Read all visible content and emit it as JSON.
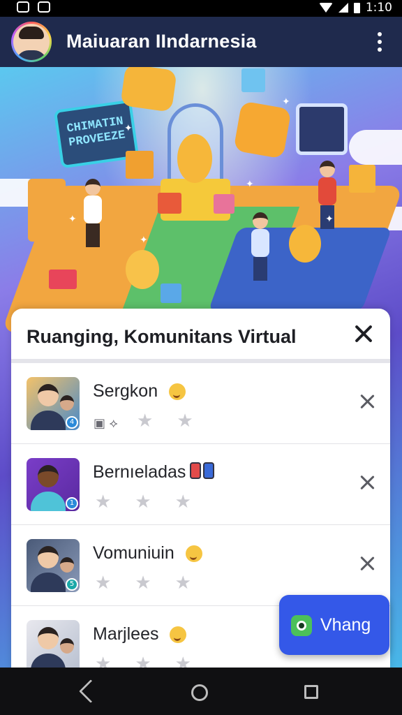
{
  "status_bar": {
    "time": "1:10"
  },
  "app_bar": {
    "title": "Maiuaran IIndarnesia"
  },
  "hero": {
    "sign_text": "CHIMATIN PROVEEZE"
  },
  "dialog": {
    "title": "Ruanging, Komunitans Virtual",
    "items": [
      {
        "name": "Sergkon",
        "badge": "4",
        "rating": 0
      },
      {
        "name": "Bernıeladas",
        "badge": "1",
        "rating": 0
      },
      {
        "name": "Vomuniuin",
        "badge": "5",
        "rating": 0
      },
      {
        "name": "Marjlees",
        "badge": "",
        "rating": 0
      }
    ]
  },
  "fab": {
    "label": "Vhang"
  },
  "colors": {
    "app_bar": "#1f2a4d",
    "fab": "#3458e8",
    "star_empty": "#c9c9cf"
  }
}
